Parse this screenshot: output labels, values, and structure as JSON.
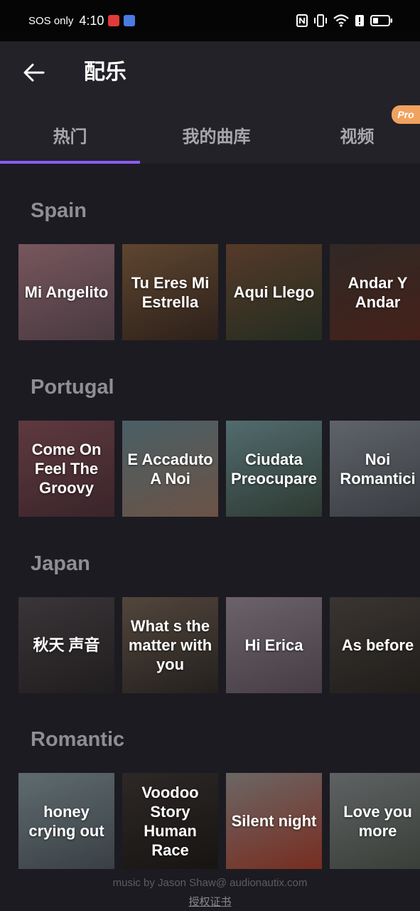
{
  "status_bar": {
    "carrier": "SOS only",
    "time": "4:10"
  },
  "header": {
    "title": "配乐"
  },
  "tabs": [
    {
      "label": "热门"
    },
    {
      "label": "我的曲库"
    },
    {
      "label": "视频"
    }
  ],
  "pro_badge": "Pro",
  "sections": [
    {
      "title": "Spain",
      "tracks": [
        {
          "label": "Mi Angelito",
          "colors": [
            "#9a6f78",
            "#5d4a52"
          ]
        },
        {
          "label": "Tu Eres Mi Estrella",
          "colors": [
            "#7a5a3e",
            "#3a2a22"
          ]
        },
        {
          "label": "Aqui Llego",
          "colors": [
            "#6e4a35",
            "#2f3a2a"
          ]
        },
        {
          "label": "Andar Y Andar",
          "colors": [
            "#3e3530",
            "#5a2a22"
          ]
        }
      ]
    },
    {
      "title": "Portugal",
      "tracks": [
        {
          "label": "Come On Feel The Groovy",
          "colors": [
            "#7a4a52",
            "#4a3036"
          ]
        },
        {
          "label": "E Accaduto A Noi",
          "colors": [
            "#5e7a82",
            "#8a6a5a"
          ]
        },
        {
          "label": "Ciudata Preocupare",
          "colors": [
            "#6a8a8e",
            "#3a4a40"
          ]
        },
        {
          "label": "Noi Romantici",
          "colors": [
            "#7a8088",
            "#4a4e54"
          ]
        }
      ]
    },
    {
      "title": "Japan",
      "tracks": [
        {
          "label": "秋天 声音",
          "colors": [
            "#4a4448",
            "#2a2628"
          ]
        },
        {
          "label": "What s the matter with you",
          "colors": [
            "#6a5a4e",
            "#2e2a26"
          ]
        },
        {
          "label": "Hi Erica",
          "colors": [
            "#8a7e88",
            "#5a4e58"
          ]
        },
        {
          "label": "As before",
          "colors": [
            "#4a4440",
            "#2a2622"
          ]
        }
      ]
    },
    {
      "title": "Romantic",
      "tracks": [
        {
          "label": "honey crying out",
          "colors": [
            "#7a8a8e",
            "#4a5258"
          ]
        },
        {
          "label": "Voodoo Story Human Race",
          "colors": [
            "#3a3432",
            "#1e1a18"
          ]
        },
        {
          "label": "Silent night",
          "colors": [
            "#8a8482",
            "#9a3a2a"
          ]
        },
        {
          "label": "Love you more",
          "colors": [
            "#7a7e80",
            "#4a5048"
          ]
        }
      ]
    }
  ],
  "footer": {
    "credit": "music by Jason Shaw@ audionautix.com",
    "license_link": "授权证书"
  }
}
